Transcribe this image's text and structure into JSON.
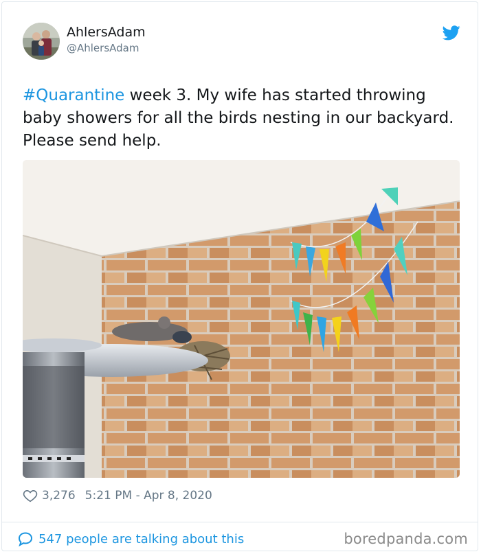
{
  "user": {
    "display_name": "AhlersAdam",
    "handle": "@AhlersAdam"
  },
  "tweet": {
    "hashtag": "#Quarantine",
    "text": " week 3. My wife has started throwing baby showers for all the birds nesting in our backyard. Please send help."
  },
  "meta": {
    "likes": "3,276",
    "timestamp": "5:21 PM - Apr 8, 2020"
  },
  "footer": {
    "conversation": "547 people are talking about this",
    "source": "boredpanda.com"
  },
  "icons": {
    "logo": "twitter-bird-icon",
    "like": "heart-icon",
    "reply": "speech-bubble-icon"
  },
  "colors": {
    "accent": "#1b95e0",
    "secondary_text": "#657786"
  }
}
